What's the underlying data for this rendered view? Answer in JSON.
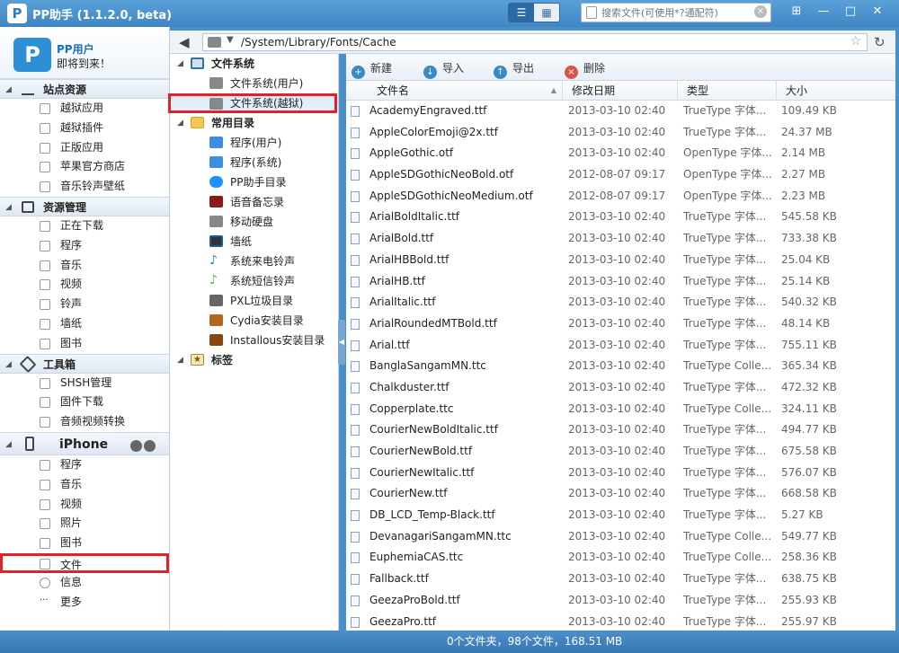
{
  "app": {
    "logo_glyph": "P",
    "title": "PP助手 (1.1.2.0, beta)",
    "view_toggle": [
      "☰",
      "▦"
    ],
    "search_placeholder": "搜索文件(可使用*?通配符)",
    "window_buttons": [
      "⊞",
      "—",
      "□",
      "✕"
    ]
  },
  "user": {
    "avatar_glyph": "P",
    "name": "PP用户",
    "subtitle": "即将到来！"
  },
  "nav": {
    "groups": [
      {
        "label": "站点资源",
        "items": [
          "越狱应用",
          "越狱插件",
          "正版应用",
          "苹果官方商店",
          "音乐铃声壁纸"
        ]
      },
      {
        "label": "资源管理",
        "items": [
          "正在下载",
          "程序",
          "音乐",
          "视频",
          "铃声",
          "墙纸",
          "图书"
        ]
      },
      {
        "label": "工具箱",
        "items": [
          "SHSH管理",
          "固件下载",
          "音频视频转换"
        ]
      },
      {
        "label": "iPhone",
        "items": [
          "程序",
          "音乐",
          "视频",
          "照片",
          "图书",
          "文件",
          "信息",
          "更多"
        ]
      }
    ],
    "selected_item": "文件"
  },
  "tree": {
    "root_fs": "文件系统",
    "fs_user": "文件系统(用户)",
    "fs_jailbreak": "文件系统(越狱)",
    "root_common": "常用目录",
    "common_items": [
      "程序(用户)",
      "程序(系统)",
      "PP助手目录",
      "语音备忘录",
      "移动硬盘",
      "墙纸",
      "系统来电铃声",
      "系统短信铃声",
      "PXL垃圾目录",
      "Cydia安装目录",
      "Installous安装目录"
    ],
    "root_tags": "标签"
  },
  "path": {
    "back": "◀",
    "value": "/System/Library/Fonts/Cache",
    "star": "☆",
    "refresh": "↻"
  },
  "toolbar": {
    "new_label": "新建",
    "import_label": "导入",
    "export_label": "导出",
    "delete_label": "删除"
  },
  "table": {
    "col_name": "文件名",
    "col_date": "修改日期",
    "col_type": "类型",
    "col_size": "大小",
    "rows": [
      {
        "name": "AcademyEngraved.ttf",
        "date": "2013-03-10 02:40",
        "type": "TrueType 字体...",
        "size": "109.49 KB"
      },
      {
        "name": "AppleColorEmoji@2x.ttf",
        "date": "2013-03-10 02:40",
        "type": "TrueType 字体...",
        "size": "24.37 MB"
      },
      {
        "name": "AppleGothic.otf",
        "date": "2013-03-10 02:40",
        "type": "OpenType 字体...",
        "size": "2.14 MB"
      },
      {
        "name": "AppleSDGothicNeoBold.otf",
        "date": "2012-08-07 09:17",
        "type": "OpenType 字体...",
        "size": "2.27 MB"
      },
      {
        "name": "AppleSDGothicNeoMedium.otf",
        "date": "2012-08-07 09:17",
        "type": "OpenType 字体...",
        "size": "2.23 MB"
      },
      {
        "name": "ArialBoldItalic.ttf",
        "date": "2013-03-10 02:40",
        "type": "TrueType 字体...",
        "size": "545.58 KB"
      },
      {
        "name": "ArialBold.ttf",
        "date": "2013-03-10 02:40",
        "type": "TrueType 字体...",
        "size": "733.38 KB"
      },
      {
        "name": "ArialHBBold.ttf",
        "date": "2013-03-10 02:40",
        "type": "TrueType 字体...",
        "size": "25.04 KB"
      },
      {
        "name": "ArialHB.ttf",
        "date": "2013-03-10 02:40",
        "type": "TrueType 字体...",
        "size": "25.14 KB"
      },
      {
        "name": "ArialItalic.ttf",
        "date": "2013-03-10 02:40",
        "type": "TrueType 字体...",
        "size": "540.32 KB"
      },
      {
        "name": "ArialRoundedMTBold.ttf",
        "date": "2013-03-10 02:40",
        "type": "TrueType 字体...",
        "size": "48.14 KB"
      },
      {
        "name": "Arial.ttf",
        "date": "2013-03-10 02:40",
        "type": "TrueType 字体...",
        "size": "755.11 KB"
      },
      {
        "name": "BanglaSangamMN.ttc",
        "date": "2013-03-10 02:40",
        "type": "TrueType Colle...",
        "size": "365.34 KB"
      },
      {
        "name": "Chalkduster.ttf",
        "date": "2013-03-10 02:40",
        "type": "TrueType 字体...",
        "size": "472.32 KB"
      },
      {
        "name": "Copperplate.ttc",
        "date": "2013-03-10 02:40",
        "type": "TrueType Colle...",
        "size": "324.11 KB"
      },
      {
        "name": "CourierNewBoldItalic.ttf",
        "date": "2013-03-10 02:40",
        "type": "TrueType 字体...",
        "size": "494.77 KB"
      },
      {
        "name": "CourierNewBold.ttf",
        "date": "2013-03-10 02:40",
        "type": "TrueType 字体...",
        "size": "675.58 KB"
      },
      {
        "name": "CourierNewItalic.ttf",
        "date": "2013-03-10 02:40",
        "type": "TrueType 字体...",
        "size": "576.07 KB"
      },
      {
        "name": "CourierNew.ttf",
        "date": "2013-03-10 02:40",
        "type": "TrueType 字体...",
        "size": "668.58 KB"
      },
      {
        "name": "DB_LCD_Temp-Black.ttf",
        "date": "2013-03-10 02:40",
        "type": "TrueType 字体...",
        "size": "5.27 KB"
      },
      {
        "name": "DevanagariSangamMN.ttc",
        "date": "2013-03-10 02:40",
        "type": "TrueType Colle...",
        "size": "549.77 KB"
      },
      {
        "name": "EuphemiaCAS.ttc",
        "date": "2013-03-10 02:40",
        "type": "TrueType Colle...",
        "size": "258.36 KB"
      },
      {
        "name": "Fallback.ttf",
        "date": "2013-03-10 02:40",
        "type": "TrueType 字体...",
        "size": "638.75 KB"
      },
      {
        "name": "GeezaProBold.ttf",
        "date": "2013-03-10 02:40",
        "type": "TrueType 字体...",
        "size": "255.93 KB"
      },
      {
        "name": "GeezaPro.ttf",
        "date": "2013-03-10 02:40",
        "type": "TrueType 字体...",
        "size": "255.97 KB"
      }
    ]
  },
  "status": "0个文件夹，98个文件，168.51 MB"
}
